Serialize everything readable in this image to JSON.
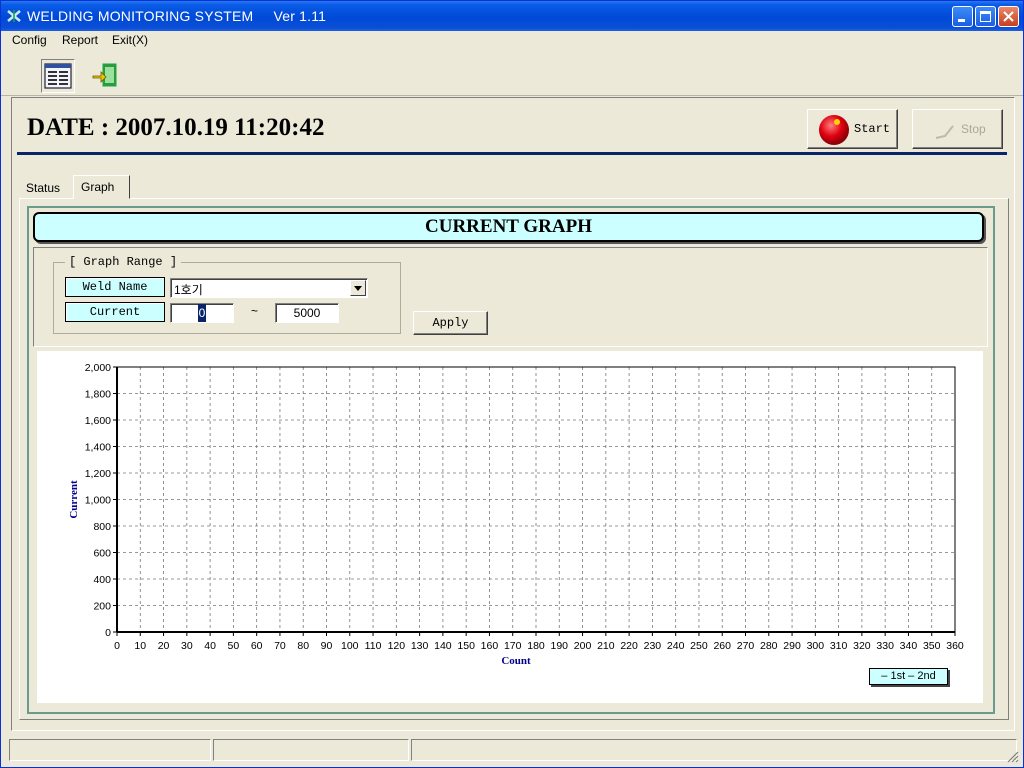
{
  "window": {
    "title": "WELDING MONITORING SYSTEM",
    "version": "Ver 1.11"
  },
  "menu": {
    "items": [
      {
        "label": "Config"
      },
      {
        "label": "Report"
      },
      {
        "label": "Exit(X)"
      }
    ]
  },
  "toolbar": {
    "buttons": [
      {
        "icon": "report-icon"
      },
      {
        "icon": "exit-door-icon"
      }
    ]
  },
  "header": {
    "date_text": "DATE : 2007.10.19  11:20:42",
    "start_label": "Start",
    "stop_label": "Stop"
  },
  "tabs": [
    {
      "label": "Status",
      "active": false
    },
    {
      "label": "Graph",
      "active": true
    }
  ],
  "graph_panel": {
    "title": "CURRENT  GRAPH",
    "range_group_title": "[ Graph Range ]",
    "weld_name_label": "Weld Name",
    "weld_name_value": "1호기",
    "current_label": "Current",
    "current_min": "0",
    "range_separator": "~",
    "current_max": "5000",
    "apply_label": "Apply"
  },
  "chart_data": {
    "type": "line",
    "xlabel": "Count",
    "ylabel": "Current",
    "xlim": [
      0,
      360
    ],
    "ylim": [
      0,
      2000
    ],
    "x_ticks": [
      0,
      10,
      20,
      30,
      40,
      50,
      60,
      70,
      80,
      90,
      100,
      110,
      120,
      130,
      140,
      150,
      160,
      170,
      180,
      190,
      200,
      210,
      220,
      230,
      240,
      250,
      260,
      270,
      280,
      290,
      300,
      310,
      320,
      330,
      340,
      350,
      360
    ],
    "y_ticks": [
      "0",
      "200",
      "400",
      "600",
      "800",
      "1,000",
      "1,200",
      "1,400",
      "1,600",
      "1,800",
      "2,000"
    ],
    "grid": true,
    "series": [
      {
        "name": "1st",
        "values": []
      },
      {
        "name": "2nd",
        "values": []
      }
    ],
    "legend_text": "– 1st  – 2nd",
    "legend_position": "bottom-right"
  },
  "colors": {
    "titlebar": "#0054e3",
    "panel_accent": "#ccffff",
    "axis_label": "#00008b",
    "divider": "#0a246a"
  }
}
